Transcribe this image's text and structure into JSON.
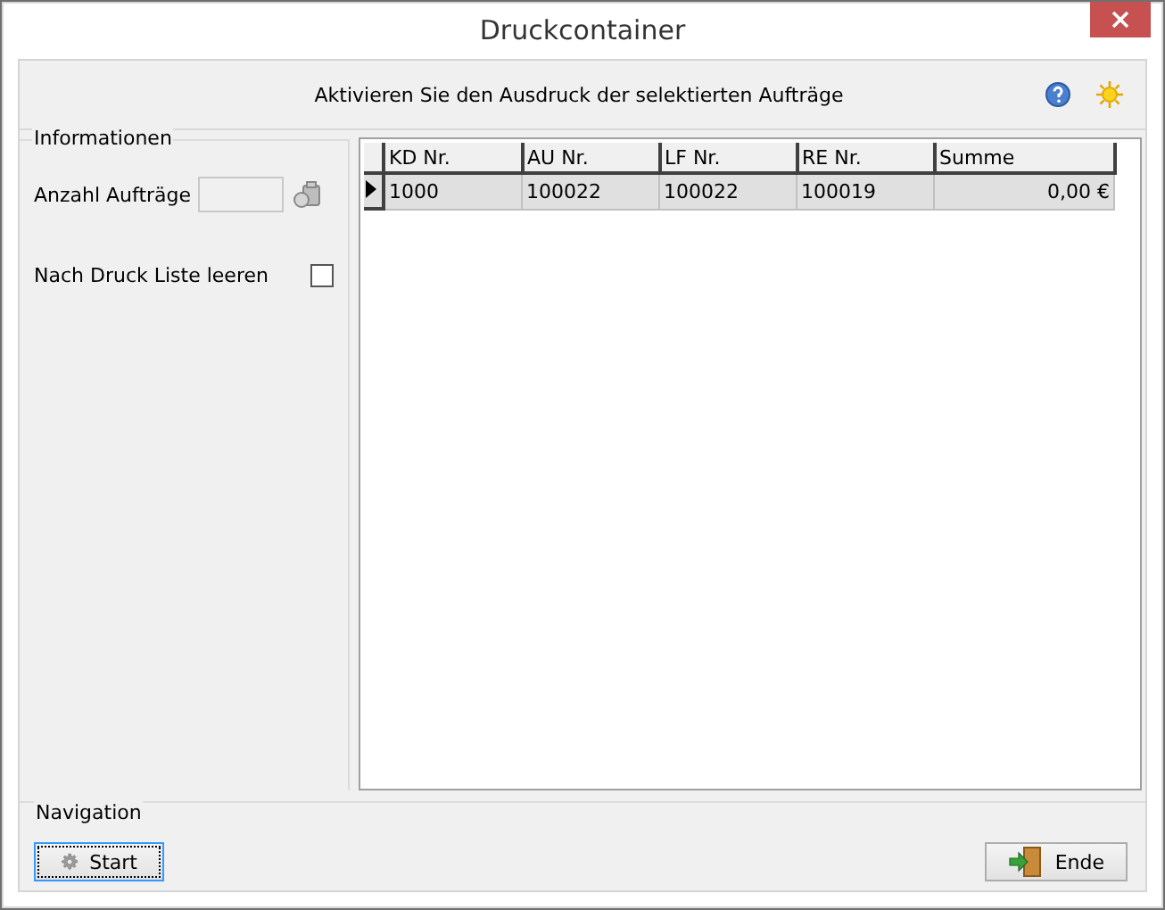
{
  "window": {
    "title": "Druckcontainer"
  },
  "header": {
    "message": "Aktivieren Sie den Ausdruck der selektierten Aufträge"
  },
  "informationen": {
    "title": "Informationen",
    "count_label": "Anzahl Aufträge",
    "clear_label": "Nach Druck Liste leeren",
    "clear_checked": false
  },
  "table": {
    "columns": [
      "KD Nr.",
      "AU Nr.",
      "LF Nr.",
      "RE Nr.",
      "Summe"
    ],
    "rows": [
      {
        "selected": true,
        "cells": [
          "1000",
          "100022",
          "100022",
          "100019",
          "0,00 €"
        ]
      }
    ]
  },
  "navigation": {
    "title": "Navigation",
    "buttons": [
      {
        "kind": "start",
        "label": "Start"
      },
      {
        "kind": "end",
        "label": "Ende"
      }
    ]
  }
}
